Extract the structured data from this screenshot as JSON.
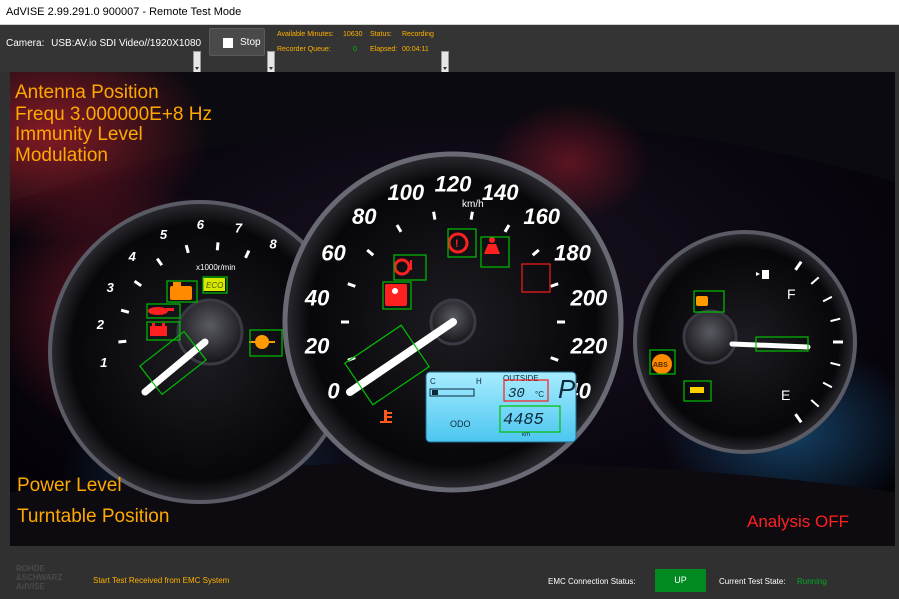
{
  "window": {
    "title": "AdVISE 2.99.291.0 900007 - Remote Test Mode"
  },
  "toolbar": {
    "camera_label": "Camera:",
    "camera_value": "USB:AV.io SDI Video//1920X1080",
    "stop_label": "Stop",
    "available_minutes_label": "Available Minutes:",
    "available_minutes_value": "10630",
    "status_label": "Status:",
    "status_value": "Recording",
    "recorder_queue_label": "Recorder Queue:",
    "recorder_queue_value": "0",
    "elapsed_label": "Elapsed:",
    "elapsed_value": "00:04:11"
  },
  "overlay": {
    "antenna_position": "Antenna Position",
    "frequency": "Frequ 3.000000E+8 Hz",
    "immunity_level": "Immunity Level",
    "modulation": "Modulation",
    "power_level": "Power Level",
    "turntable_position": "Turntable Position",
    "analysis": "Analysis OFF"
  },
  "dashboard": {
    "speed_unit": "km/h",
    "speed_ticks": [
      "0",
      "20",
      "40",
      "60",
      "80",
      "100",
      "120",
      "140",
      "160",
      "180",
      "200",
      "220",
      "240"
    ],
    "rpm_unit": "x1000r/min",
    "rpm_ticks": [
      "1",
      "2",
      "3",
      "4",
      "5",
      "6",
      "7",
      "8"
    ],
    "eco_label": "ECO",
    "fuel_full": "F",
    "fuel_empty": "E",
    "outside_label": "OUTSIDE",
    "temperature": "30",
    "temperature_unit": "°C",
    "gear": "P",
    "odometer_label": "ODO",
    "odometer_value": "4485",
    "odometer_unit": "km",
    "temp_cold": "C",
    "temp_hot": "H",
    "abs_label": "ABS"
  },
  "statusbar": {
    "logo_lines": [
      "ROHDE",
      "&SCHWARZ",
      "AdVISE"
    ],
    "start_message": "Start Test Received from EMC System",
    "emc_connection_label": "EMC Connection Status:",
    "emc_connection_value": "UP",
    "current_test_state_label": "Current Test State:",
    "current_test_state_value": "Running"
  },
  "colors": {
    "overlay_text": "#ffa800",
    "analysis_text": "#ff2020",
    "detection_green": "#00c000",
    "detection_red": "#ff1a1a",
    "up_badge": "#008a20"
  }
}
